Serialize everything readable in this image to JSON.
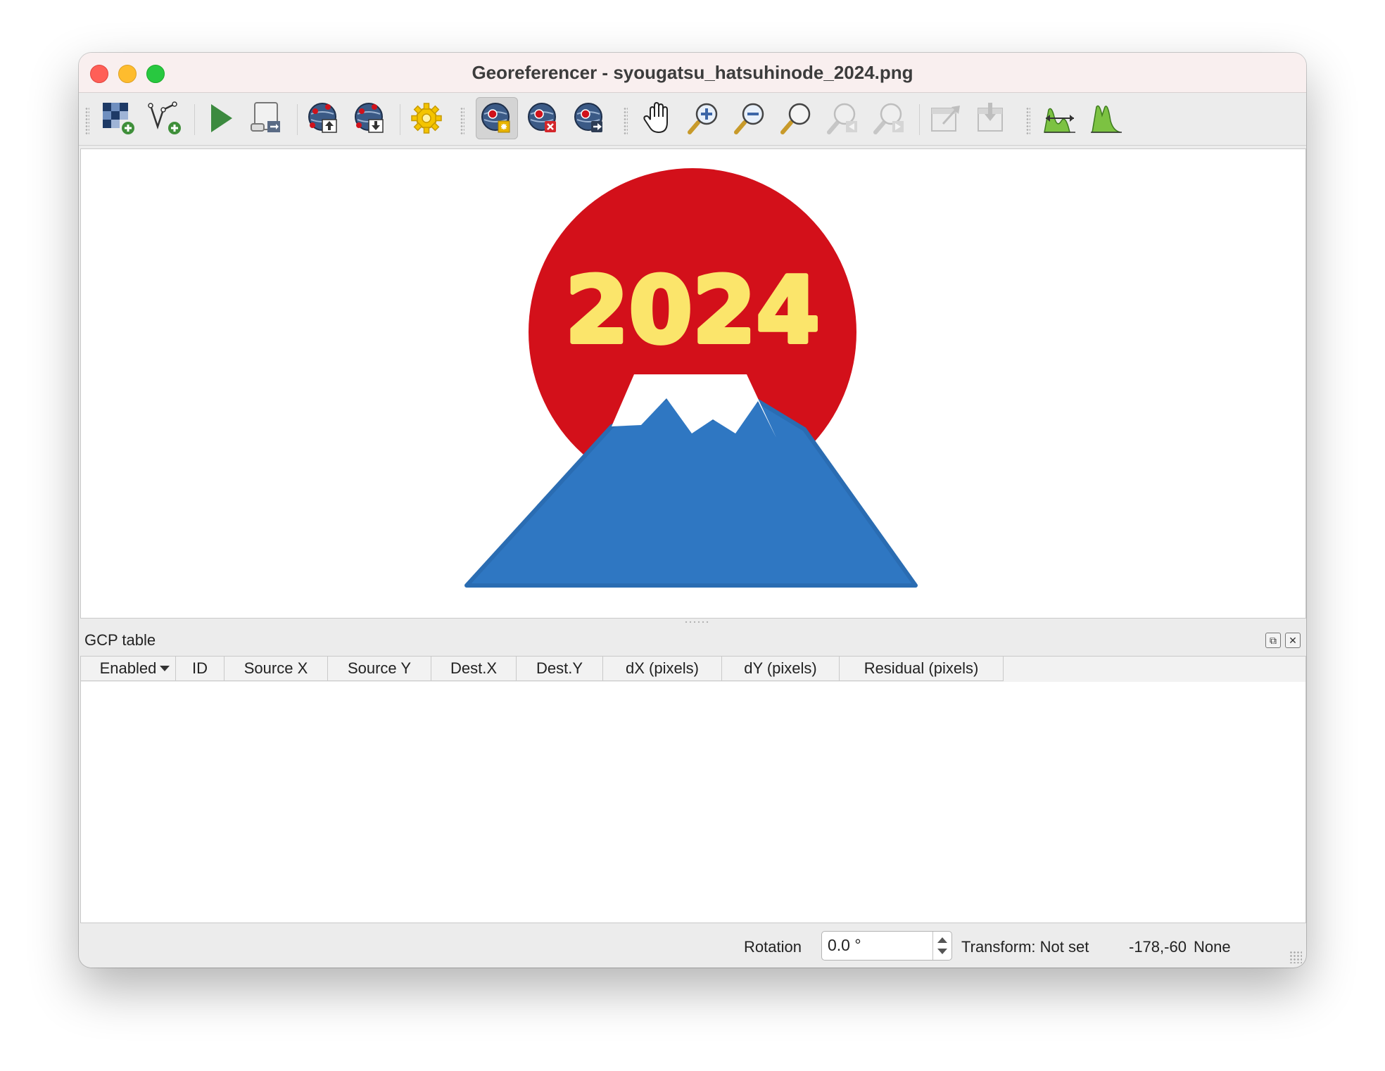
{
  "window": {
    "title": "Georeferencer - syougatsu_hatsuhinode_2024.png"
  },
  "toolbar": {
    "buttons": [
      {
        "name": "add-raster-icon"
      },
      {
        "name": "add-vector-icon"
      },
      {
        "name": "start-georeferencing-icon"
      },
      {
        "name": "generate-script-icon"
      },
      {
        "name": "load-gcp-icon"
      },
      {
        "name": "save-gcp-icon"
      },
      {
        "name": "transformation-settings-icon"
      },
      {
        "name": "add-point-icon",
        "active": true
      },
      {
        "name": "delete-point-icon"
      },
      {
        "name": "move-point-icon"
      },
      {
        "name": "pan-icon"
      },
      {
        "name": "zoom-in-icon"
      },
      {
        "name": "zoom-out-icon"
      },
      {
        "name": "zoom-to-layer-icon"
      },
      {
        "name": "zoom-last-icon"
      },
      {
        "name": "zoom-next-icon"
      },
      {
        "name": "link-georeferencer-to-qgis-icon"
      },
      {
        "name": "link-qgis-to-georeferencer-icon"
      },
      {
        "name": "full-histogram-stretch-icon"
      },
      {
        "name": "local-histogram-stretch-icon"
      }
    ]
  },
  "canvas": {
    "image": {
      "text": "2024",
      "colors": {
        "sun": "#d3101a",
        "mountain": "#2f77c2",
        "snow": "#ffffff",
        "text": "#fbe56b"
      }
    }
  },
  "gcp_table": {
    "title": "GCP table",
    "columns": [
      "Enabled",
      "ID",
      "Source X",
      "Source Y",
      "Dest.X",
      "Dest.Y",
      "dX (pixels)",
      "dY (pixels)",
      "Residual (pixels)"
    ],
    "rows": []
  },
  "status": {
    "rotation_label": "Rotation",
    "rotation_value": "0.0 °",
    "transform": "Transform: Not set",
    "coordinates": "-178,-60",
    "crs": "None"
  }
}
